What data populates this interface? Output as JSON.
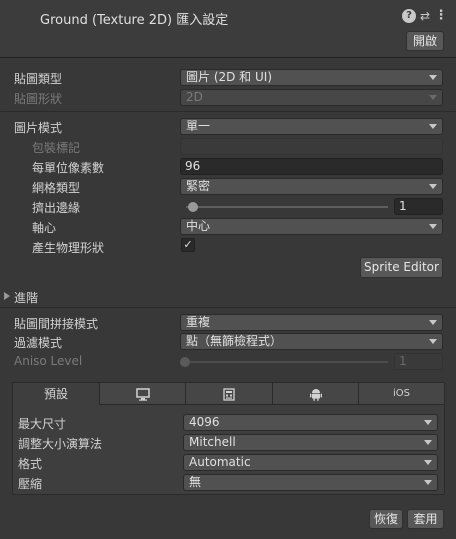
{
  "header": {
    "title": "Ground (Texture 2D) 匯入設定",
    "open_button": "開啟",
    "help_glyph": "?",
    "preset_glyph": "⇄",
    "menu_glyph": "⋮"
  },
  "settings": {
    "texture_type": {
      "label": "貼圖類型",
      "value": "圖片 (2D 和 UI)"
    },
    "texture_shape": {
      "label": "貼圖形狀",
      "value": "2D"
    },
    "sprite_mode": {
      "label": "圖片模式",
      "value": "單一"
    },
    "packing_tag": {
      "label": "包裝標記",
      "value": ""
    },
    "pixels_per_unit": {
      "label": "每單位像素數",
      "value": "96"
    },
    "mesh_type": {
      "label": "網格類型",
      "value": "緊密"
    },
    "extrude_edges": {
      "label": "擠出邊緣",
      "value": "1",
      "slider_fraction": 0.03
    },
    "pivot": {
      "label": "軸心",
      "value": "中心"
    },
    "generate_physics": {
      "label": "產生物理形狀",
      "checked": true,
      "glyph": "✓"
    },
    "sprite_editor_button": "Sprite Editor"
  },
  "advanced": {
    "label": "進階"
  },
  "wrap": {
    "wrap_mode": {
      "label": "貼圖間拼接模式",
      "value": "重複"
    },
    "filter_mode": {
      "label": "過濾模式",
      "value": "點（無篩檢程式）"
    },
    "aniso_level": {
      "label": "Aniso Level",
      "value": "1",
      "slider_fraction": 0.0
    }
  },
  "platforms": {
    "tabs": [
      {
        "label": "預設",
        "icon": ""
      },
      {
        "label": "",
        "icon": "monitor-icon"
      },
      {
        "label": "",
        "icon": "webgl-icon"
      },
      {
        "label": "",
        "icon": "android-icon"
      },
      {
        "label": "iOS",
        "icon": ""
      }
    ],
    "max_size": {
      "label": "最大尺寸",
      "value": "4096"
    },
    "resize_algorithm": {
      "label": "調整大小演算法",
      "value": "Mitchell"
    },
    "format": {
      "label": "格式",
      "value": "Automatic"
    },
    "compression": {
      "label": "壓縮",
      "value": "無"
    }
  },
  "footer": {
    "revert_button": "恢復",
    "apply_button": "套用"
  }
}
